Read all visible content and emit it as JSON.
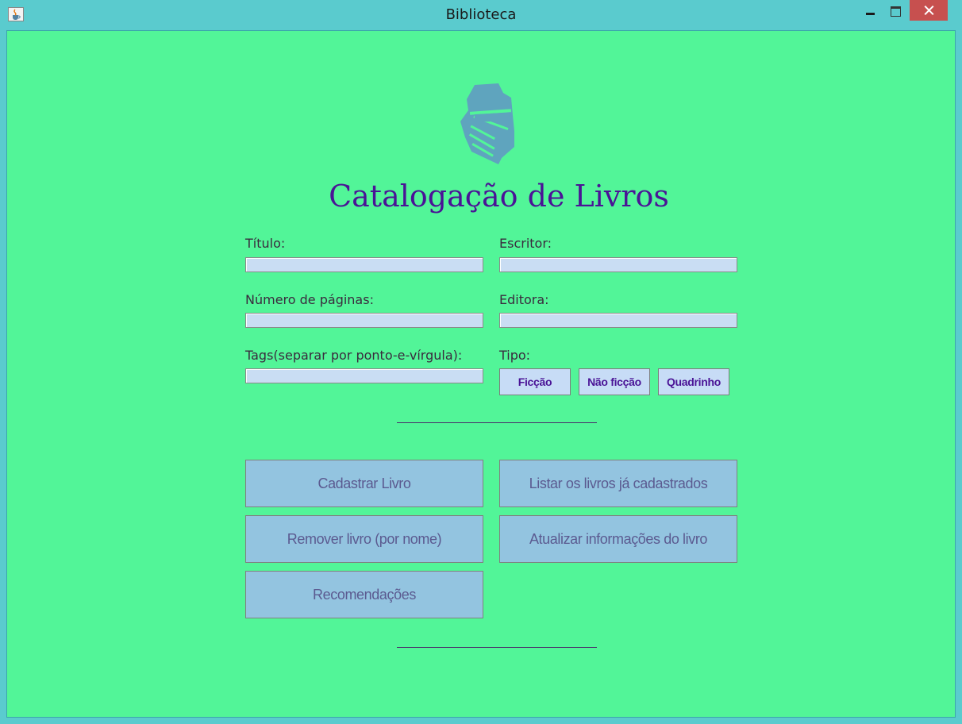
{
  "window": {
    "title": "Biblioteca"
  },
  "form": {
    "heading": "Catalogação de Livros",
    "titulo_label": "Título:",
    "escritor_label": "Escritor:",
    "paginas_label": "Número de páginas:",
    "editora_label": "Editora:",
    "tags_label": "Tags(separar por ponto-e-vírgula):",
    "tipo_label": "Tipo:",
    "titulo_value": "",
    "escritor_value": "",
    "paginas_value": "",
    "editora_value": "",
    "tags_value": "",
    "tipo_options": [
      "Ficção",
      "Não ficção",
      "Quadrinho"
    ]
  },
  "actions": {
    "cadastrar": "Cadastrar Livro",
    "listar": "Listar os livros já cadastrados",
    "remover": "Remover livro (por nome)",
    "atualizar": "Atualizar informações do livro",
    "recomendacoes": "Recomendações"
  },
  "colors": {
    "background": "#52F598",
    "heading": "#4A1396",
    "field": "#C9DDF3",
    "action_button": "#93C4E0",
    "titlebar": "#5ACBCE",
    "close_button": "#C7504F"
  },
  "icons": {
    "logo": "books-stack-icon",
    "app": "java-cup-icon"
  }
}
